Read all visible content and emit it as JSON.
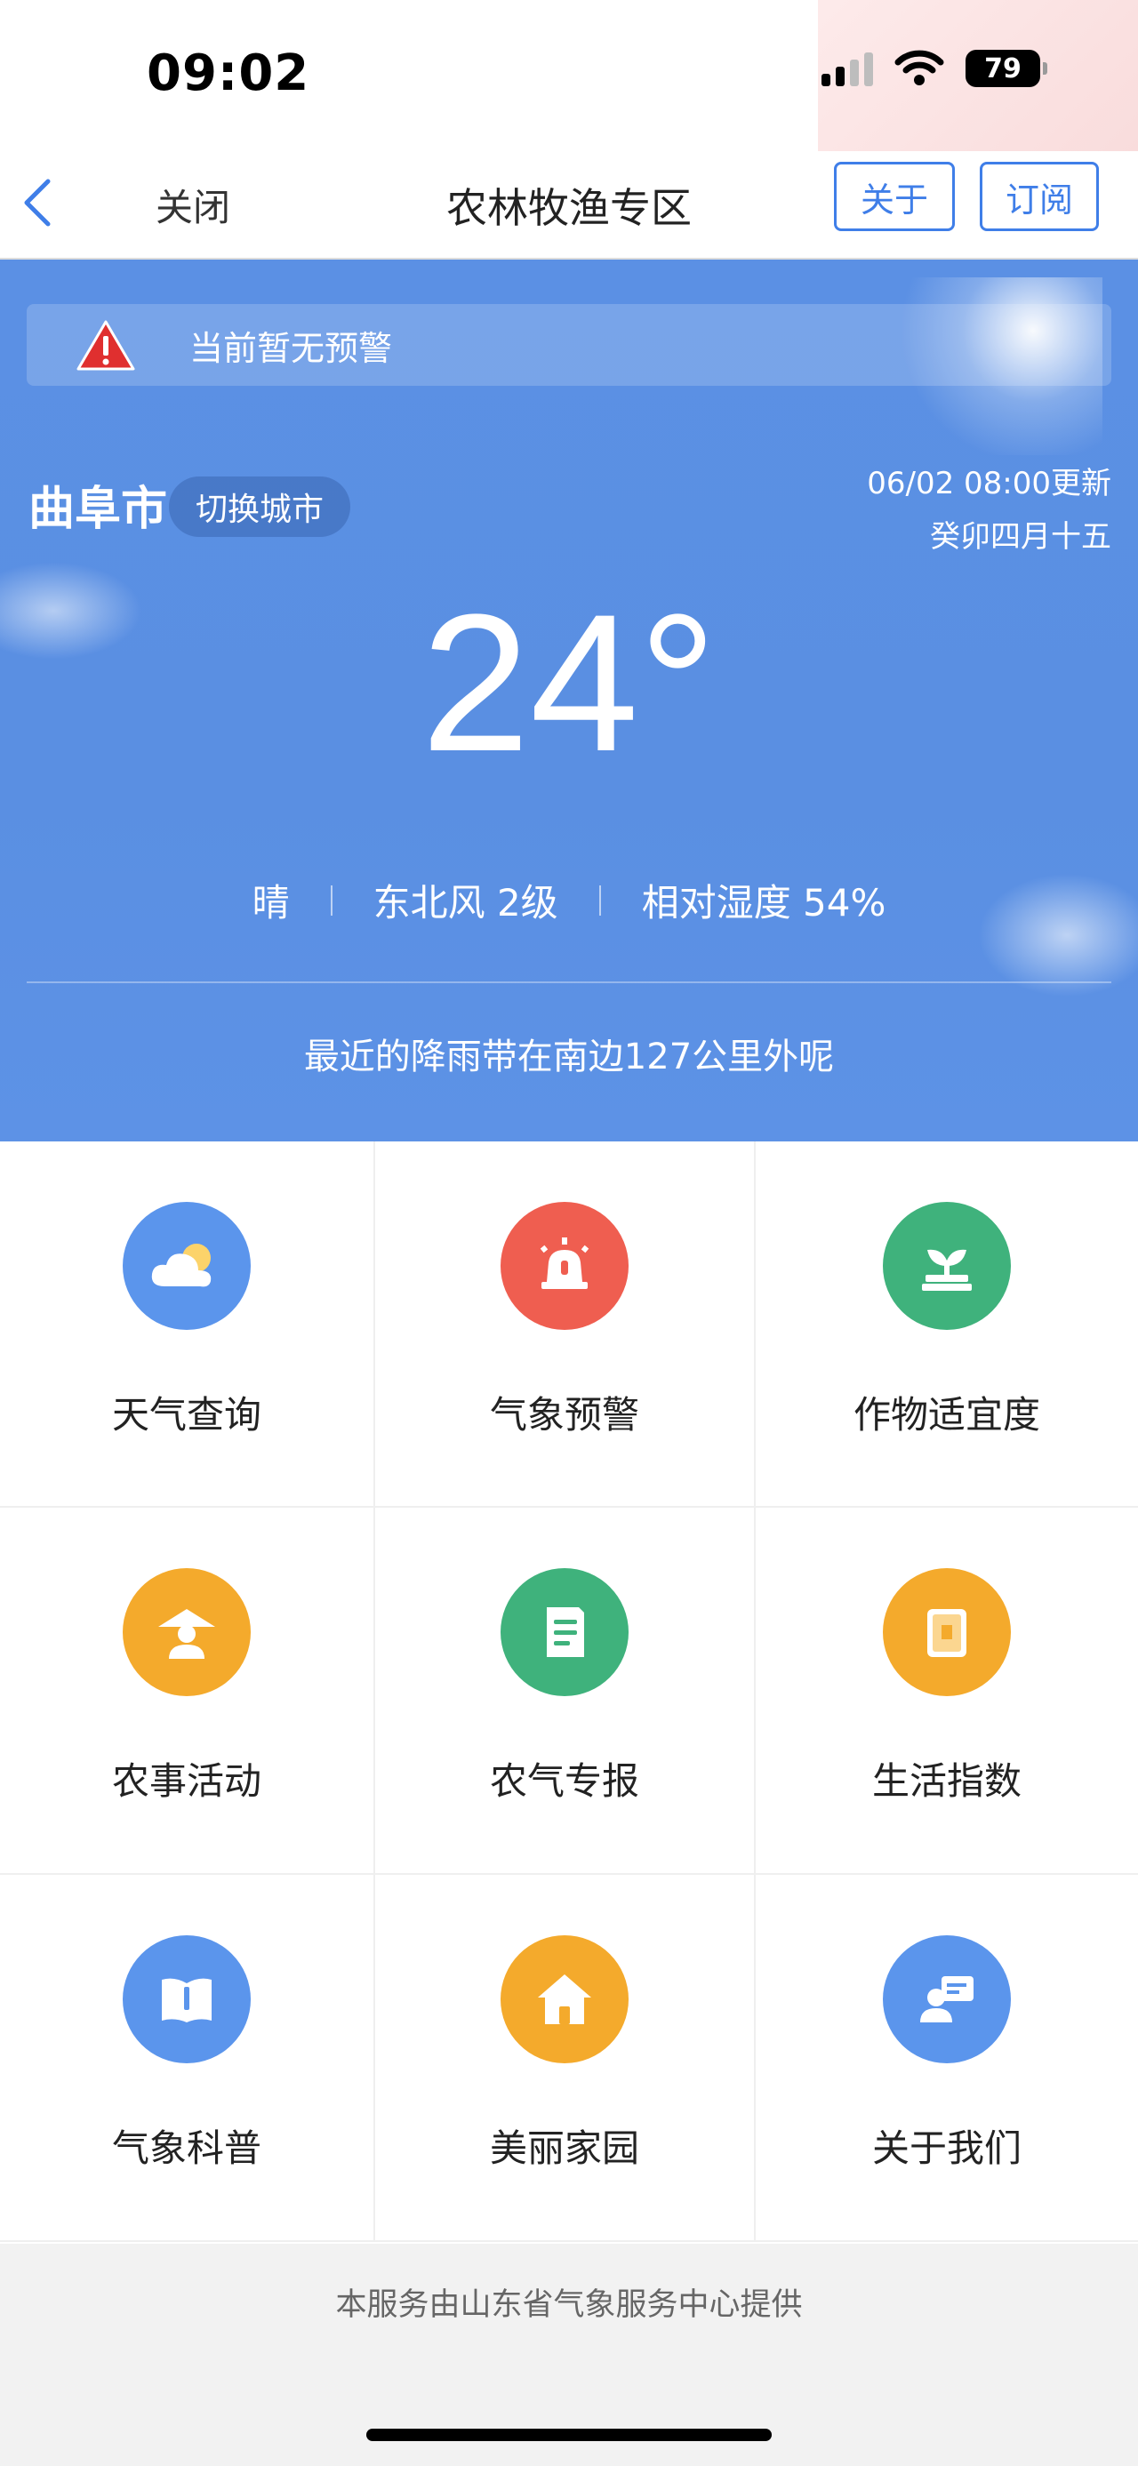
{
  "status_bar": {
    "time": "09:02",
    "battery": "79"
  },
  "nav": {
    "close_label": "关闭",
    "title": "农林牧渔专区",
    "about_label": "关于",
    "subscribe_label": "订阅"
  },
  "weather": {
    "alert_text": "当前暂无预警",
    "city": "曲阜市",
    "switch_city_label": "切换城市",
    "update_time": "06/02 08:00更新",
    "lunar_date": "癸卯四月十五",
    "temperature": "24°",
    "condition": "晴",
    "wind": "东北风 2级",
    "humidity": "相对湿度 54%",
    "rain_notice": "最近的降雨带在南边127公里外呢"
  },
  "menu": [
    {
      "label": "天气查询",
      "icon": "weather-query-icon",
      "color": "#5b95ec"
    },
    {
      "label": "气象预警",
      "icon": "weather-warning-icon",
      "color": "#ef5e50"
    },
    {
      "label": "作物适宜度",
      "icon": "crop-suitability-icon",
      "color": "#3fb27c"
    },
    {
      "label": "农事活动",
      "icon": "farm-activity-icon",
      "color": "#f4aa2c"
    },
    {
      "label": "农气专报",
      "icon": "agro-report-icon",
      "color": "#3fb27c"
    },
    {
      "label": "生活指数",
      "icon": "life-index-icon",
      "color": "#f4aa2c"
    },
    {
      "label": "气象科普",
      "icon": "meteorology-science-icon",
      "color": "#5b95ec"
    },
    {
      "label": "美丽家园",
      "icon": "beautiful-home-icon",
      "color": "#f4aa2c"
    },
    {
      "label": "关于我们",
      "icon": "about-us-icon",
      "color": "#5b95ec"
    }
  ],
  "footer": {
    "text": "本服务由山东省气象服务中心提供"
  }
}
